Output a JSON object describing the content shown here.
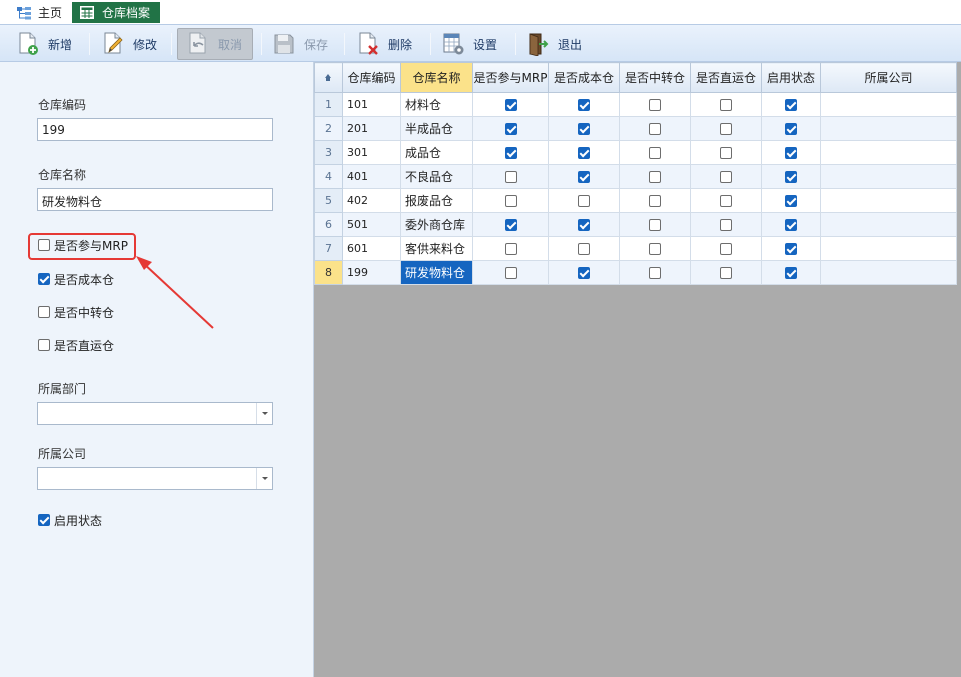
{
  "tabs": [
    {
      "label": "主页",
      "icon": "hierarchy-icon"
    },
    {
      "label": "仓库档案",
      "icon": "grid-icon",
      "active": true
    }
  ],
  "toolbar": {
    "new_label": "新增",
    "edit_label": "修改",
    "cancel_label": "取消",
    "save_label": "保存",
    "delete_label": "删除",
    "settings_label": "设置",
    "exit_label": "退出"
  },
  "form": {
    "code_label": "仓库编码",
    "code_value": "199",
    "name_label": "仓库名称",
    "name_value": "研发物料仓",
    "mrp_label": "是否参与MRP",
    "mrp_checked": false,
    "cost_label": "是否成本仓",
    "cost_checked": true,
    "transit_label": "是否中转仓",
    "transit_checked": false,
    "direct_label": "是否直运仓",
    "direct_checked": false,
    "dept_label": "所属部门",
    "dept_value": "",
    "company_label": "所属公司",
    "company_value": "",
    "enabled_label": "启用状态",
    "enabled_checked": true
  },
  "grid": {
    "columns": [
      "仓库编码",
      "仓库名称",
      "是否参与MRP",
      "是否成本仓",
      "是否中转仓",
      "是否直运仓",
      "启用状态",
      "所属公司"
    ],
    "rows": [
      {
        "n": "1",
        "code": "101",
        "name": "材料仓",
        "mrp": true,
        "cost": true,
        "transit": false,
        "direct": false,
        "enabled": true,
        "company": ""
      },
      {
        "n": "2",
        "code": "201",
        "name": "半成品仓",
        "mrp": true,
        "cost": true,
        "transit": false,
        "direct": false,
        "enabled": true,
        "company": ""
      },
      {
        "n": "3",
        "code": "301",
        "name": "成品仓",
        "mrp": true,
        "cost": true,
        "transit": false,
        "direct": false,
        "enabled": true,
        "company": ""
      },
      {
        "n": "4",
        "code": "401",
        "name": "不良品仓",
        "mrp": false,
        "cost": true,
        "transit": false,
        "direct": false,
        "enabled": true,
        "company": ""
      },
      {
        "n": "5",
        "code": "402",
        "name": "报废品仓",
        "mrp": false,
        "cost": false,
        "transit": false,
        "direct": false,
        "enabled": true,
        "company": ""
      },
      {
        "n": "6",
        "code": "501",
        "name": "委外商仓库",
        "mrp": true,
        "cost": true,
        "transit": false,
        "direct": false,
        "enabled": true,
        "company": ""
      },
      {
        "n": "7",
        "code": "601",
        "name": "客供来料仓",
        "mrp": false,
        "cost": false,
        "transit": false,
        "direct": false,
        "enabled": true,
        "company": ""
      },
      {
        "n": "8",
        "code": "199",
        "name": "研发物料仓",
        "mrp": false,
        "cost": true,
        "transit": false,
        "direct": false,
        "enabled": true,
        "company": ""
      }
    ],
    "current_row": 8
  },
  "colors": {
    "active_tab": "#217346",
    "checked": "#1565c0",
    "highlight": "#e53935",
    "selected_header": "#fbe28a"
  }
}
